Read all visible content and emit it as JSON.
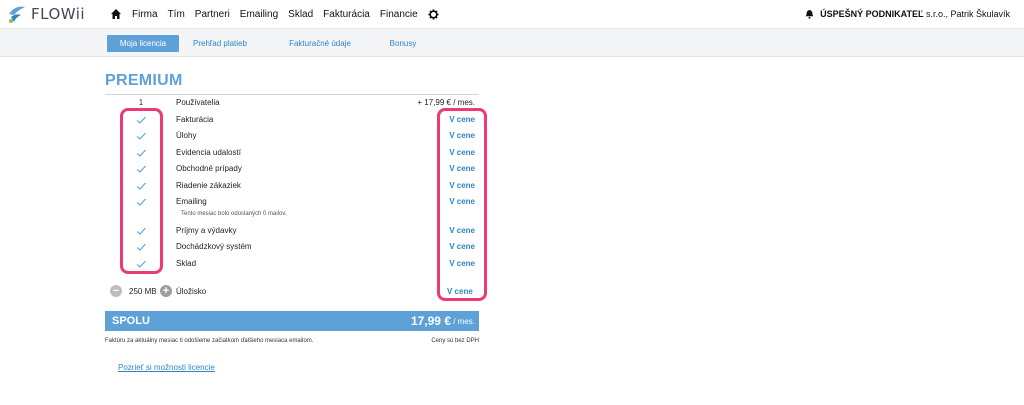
{
  "brand": {
    "logo_text": "FLOWii"
  },
  "nav": {
    "home_icon": "home-icon",
    "items": [
      "Firma",
      "Tím",
      "Partneri",
      "Emailing",
      "Sklad",
      "Fakturácia",
      "Financie"
    ],
    "settings_icon": "gear-icon"
  },
  "account": {
    "bell_icon": "bell-icon",
    "company": "ÚSPEŠNÝ PODNIKATEĽ",
    "suffix": "s.r.o., Patrik Škulavík"
  },
  "tabs": [
    {
      "label": "Moja licencia",
      "active": true
    },
    {
      "label": "Prehľad platieb",
      "active": false
    },
    {
      "label": "Fakturačné údaje",
      "active": false
    },
    {
      "label": "Bonusy",
      "active": false
    }
  ],
  "plan": {
    "title": "PREMIUM",
    "users": {
      "qty": "1",
      "name": "Používatelia",
      "price": "+ 17,99 € / mes."
    },
    "included_label": "V cene",
    "features": [
      "Fakturácia",
      "Úlohy",
      "Evidencia udalostí",
      "Obchodné prípady",
      "Riadenie zákaziek",
      "Emailing",
      "Príjmy a výdavky",
      "Dochádzkový systém",
      "Sklad"
    ],
    "emailing_note": "Tento mesiac bolo odoslaných 0 mailov.",
    "storage": {
      "value": "250 MB",
      "name": "Úložisko",
      "minus": "−",
      "plus": "+"
    },
    "total": {
      "label": "SPOLU",
      "amount": "17,99 €",
      "unit": "/ mes."
    },
    "footer_left": "Faktúru za aktuálny mesiac ti odošleme začiatkom ďalšieho mesiaca emailom.",
    "footer_right": "Ceny sú bez DPH",
    "more_link": "Pozrieť si možnosti licencie"
  },
  "colors": {
    "accent": "#5ea1d8",
    "link": "#2e86c8",
    "highlight": "#ec3a74"
  }
}
